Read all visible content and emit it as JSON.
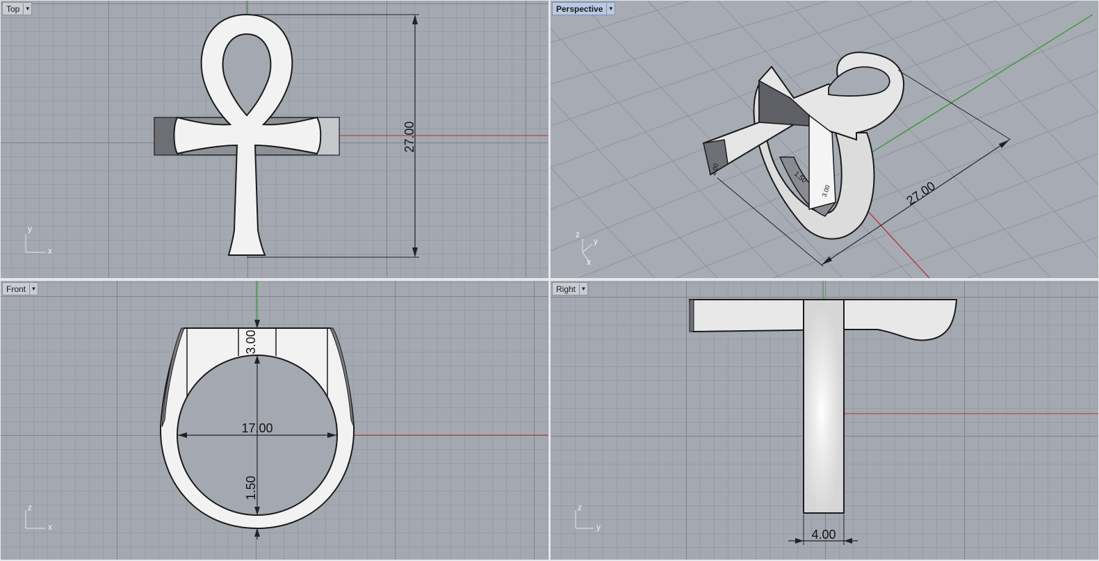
{
  "viewports": {
    "top": {
      "title": "Top",
      "dim_height": "27.00",
      "axis_v": "y",
      "axis_h": "x"
    },
    "perspective": {
      "title": "Perspective",
      "dim_length": "27.00",
      "dim_small_1": "1.50",
      "dim_small_2": "3.00",
      "dim_small_3": "4.00",
      "axis_z": "z",
      "axis_y": "y",
      "axis_x": "x"
    },
    "front": {
      "title": "Front",
      "dim_top": "3.00",
      "dim_width": "17.00",
      "dim_bottom": "1.50",
      "axis_v": "z",
      "axis_h": "x"
    },
    "right": {
      "title": "Right",
      "dim_width": "4.00",
      "axis_v": "z",
      "axis_h": "y"
    }
  },
  "icons": {
    "dropdown": "chevron-down-icon"
  },
  "colors": {
    "viewport_bg": "#a4a8b0",
    "grid_line": "#7d8088",
    "x_axis": "#b43232",
    "y_axis": "#2e9a2e",
    "active_tab": "#b8c9e4",
    "model_fill": "#f2f2f2"
  }
}
